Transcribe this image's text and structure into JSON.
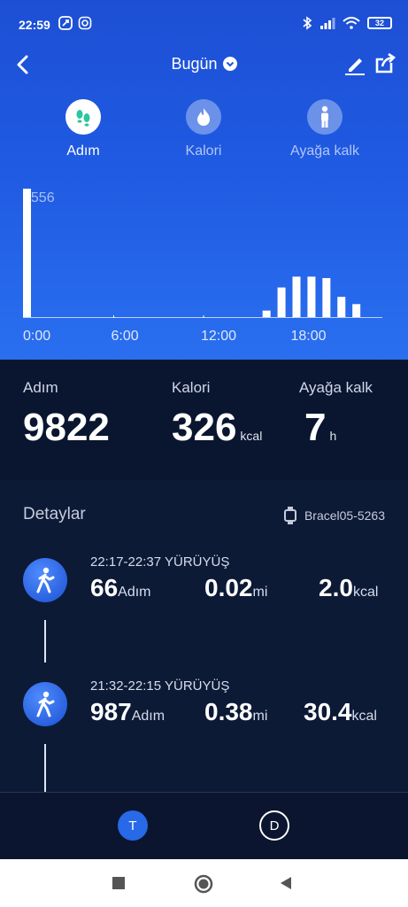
{
  "status": {
    "time": "22:59",
    "battery": "32"
  },
  "nav": {
    "title": "Bugün"
  },
  "modes": [
    {
      "label": "Adım",
      "icon": "footprints-icon"
    },
    {
      "label": "Kalori",
      "icon": "flame-icon"
    },
    {
      "label": "Ayağa kalk",
      "icon": "standing-person-icon"
    }
  ],
  "chart_data": {
    "type": "bar",
    "x_ticks": [
      "0:00",
      "6:00",
      "12:00",
      "18:00"
    ],
    "max_label": "3556",
    "ylim": [
      0,
      3556
    ],
    "categories": [
      "0",
      "1",
      "2",
      "3",
      "4",
      "5",
      "6",
      "7",
      "8",
      "9",
      "10",
      "11",
      "12",
      "13",
      "14",
      "15",
      "16",
      "17",
      "18",
      "19",
      "20",
      "21",
      "22",
      "23"
    ],
    "values": [
      3556,
      0,
      0,
      0,
      0,
      0,
      0,
      0,
      0,
      0,
      0,
      0,
      0,
      0,
      0,
      0,
      180,
      820,
      1120,
      1120,
      1080,
      560,
      360,
      0
    ]
  },
  "summary": {
    "steps": {
      "label": "Adım",
      "value": "9822",
      "unit": ""
    },
    "calories": {
      "label": "Kalori",
      "value": "326",
      "unit": "kcal"
    },
    "stand": {
      "label": "Ayağa kalk",
      "value": "7",
      "unit": "h"
    }
  },
  "details": {
    "heading": "Detaylar",
    "device": "Bracel05-5263",
    "activities": [
      {
        "time": "22:17-22:37",
        "type": "YÜRÜYÜŞ",
        "steps": "66",
        "steps_unit": "Adım",
        "distance": "0.02",
        "distance_unit": "mi",
        "calories": "2.0",
        "calories_unit": "kcal"
      },
      {
        "time": "21:32-22:15",
        "type": "YÜRÜYÜŞ",
        "steps": "987",
        "steps_unit": "Adım",
        "distance": "0.38",
        "distance_unit": "mi",
        "calories": "30.4",
        "calories_unit": "kcal"
      }
    ]
  },
  "tabs": {
    "t": "T",
    "d": "D"
  },
  "colors": {
    "accent": "#2769e6",
    "background": "#0b1530"
  }
}
